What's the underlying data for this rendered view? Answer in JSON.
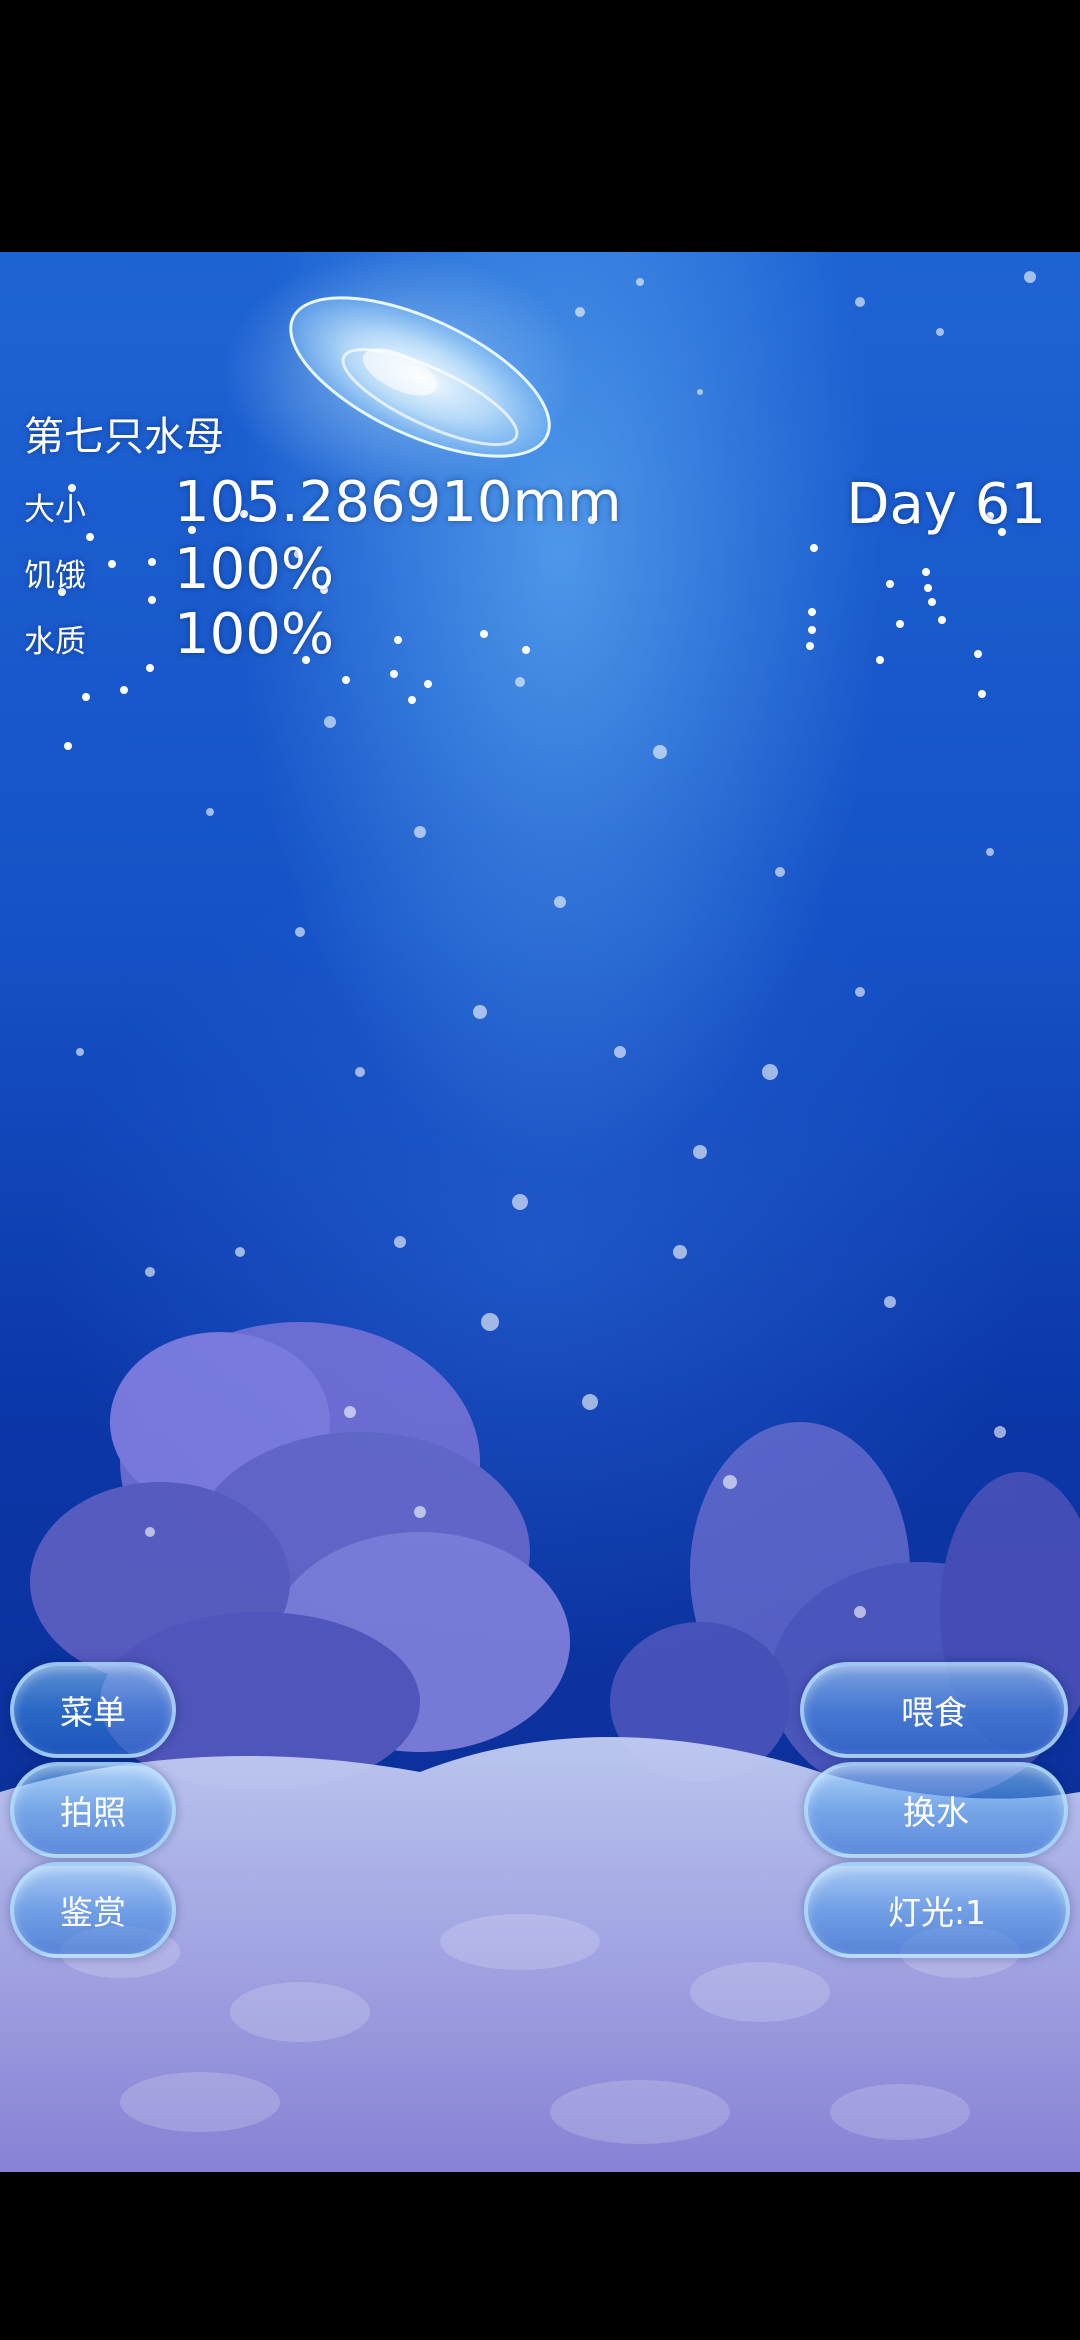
{
  "hud": {
    "title": "第七只水母",
    "size_label": "大小",
    "size_value": "105.286910mm",
    "hunger_label": "饥饿",
    "hunger_value": "100%",
    "water_label": "水质",
    "water_value": "100%",
    "day": "Day 61"
  },
  "buttons_left": {
    "menu": "菜单",
    "photo": "拍照",
    "gallery": "鉴赏"
  },
  "buttons_right": {
    "feed": "喂食",
    "change_water": "换水",
    "light": "灯光:1"
  },
  "colors": {
    "water_top": "#1e63d4",
    "water_bottom": "#0a2a8e",
    "coral": "#8a86e0",
    "sand": "#a8a6e8"
  }
}
